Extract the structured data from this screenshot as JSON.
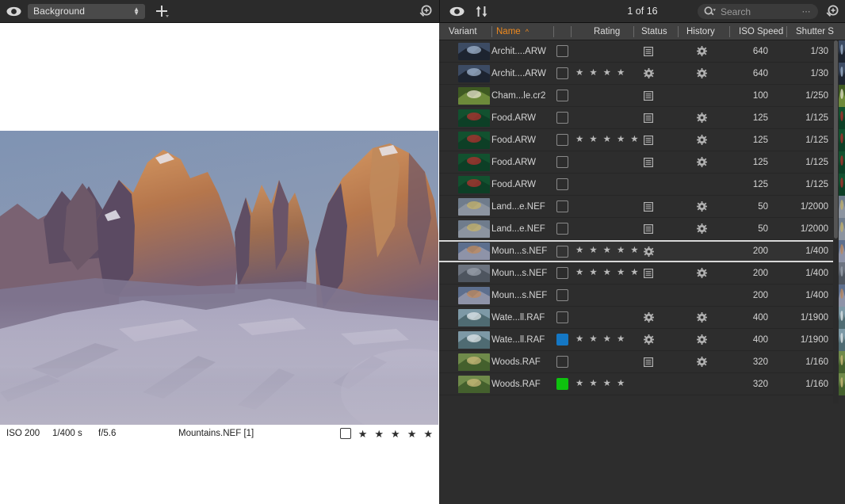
{
  "left_toolbar": {
    "eye_icon": "eye-icon",
    "background_select": {
      "value": "Background"
    },
    "add_icon": "plus-icon",
    "zoom_icon": "zoom-in-icon"
  },
  "viewer": {
    "photo_alt": "Mountains at sunset"
  },
  "info_bar": {
    "iso": "ISO 200",
    "shutter": "1/400 s",
    "aperture": "f/5.6",
    "filename": "Mountains.NEF [1]",
    "rating_checkbox": "unchecked",
    "stars": 5
  },
  "right_toolbar": {
    "eye_icon": "eye-icon",
    "sort_icon": "sort-arrows-icon",
    "count_label": "1 of 16",
    "search": {
      "placeholder": "Search",
      "value": "",
      "icon": "search-icon",
      "more_icon": "ellipsis-icon"
    },
    "zoom_icon": "zoom-in-icon"
  },
  "table": {
    "columns": [
      {
        "key": "variant",
        "label": "Variant"
      },
      {
        "key": "name",
        "label": "Name",
        "sorted": true,
        "sort_dir": "asc"
      },
      {
        "key": "rating",
        "label": "Rating"
      },
      {
        "key": "status",
        "label": "Status"
      },
      {
        "key": "history",
        "label": "History"
      },
      {
        "key": "iso",
        "label": "ISO Speed"
      },
      {
        "key": "shutter",
        "label": "Shutter S"
      }
    ],
    "sort_caret": "^",
    "rows": [
      {
        "name": "Archit....ARW",
        "label": "none",
        "stars": 0,
        "status": "list",
        "history": "gear",
        "iso": "640",
        "shutter": "1/30",
        "thumb": "architecture",
        "selected": false
      },
      {
        "name": "Archit....ARW",
        "label": "none",
        "stars": 4,
        "status": "gear",
        "history": "gear",
        "iso": "640",
        "shutter": "1/30",
        "thumb": "architecture",
        "selected": false
      },
      {
        "name": "Cham...le.cr2",
        "label": "none",
        "stars": 0,
        "status": "list",
        "history": "none",
        "iso": "100",
        "shutter": "1/250",
        "thumb": "chamomile",
        "selected": false
      },
      {
        "name": "Food.ARW",
        "label": "none",
        "stars": 0,
        "status": "list",
        "history": "gear",
        "iso": "125",
        "shutter": "1/125",
        "thumb": "food",
        "selected": false
      },
      {
        "name": "Food.ARW",
        "label": "none",
        "stars": 5,
        "status": "list",
        "history": "gear",
        "iso": "125",
        "shutter": "1/125",
        "thumb": "food",
        "selected": false
      },
      {
        "name": "Food.ARW",
        "label": "none",
        "stars": 0,
        "status": "list",
        "history": "gear",
        "iso": "125",
        "shutter": "1/125",
        "thumb": "food",
        "selected": false
      },
      {
        "name": "Food.ARW",
        "label": "none",
        "stars": 0,
        "status": "none",
        "history": "none",
        "iso": "125",
        "shutter": "1/125",
        "thumb": "food",
        "selected": false
      },
      {
        "name": "Land...e.NEF",
        "label": "none",
        "stars": 0,
        "status": "list",
        "history": "gear",
        "iso": "50",
        "shutter": "1/2000",
        "thumb": "landscape",
        "selected": false
      },
      {
        "name": "Land...e.NEF",
        "label": "none",
        "stars": 0,
        "status": "list",
        "history": "gear",
        "iso": "50",
        "shutter": "1/2000",
        "thumb": "landscape",
        "selected": false
      },
      {
        "name": "Moun...s.NEF",
        "label": "none",
        "stars": 5,
        "status": "gear",
        "history": "none",
        "iso": "200",
        "shutter": "1/400",
        "thumb": "mountains-warm",
        "selected": true
      },
      {
        "name": "Moun...s.NEF",
        "label": "none",
        "stars": 5,
        "status": "list",
        "history": "gear",
        "iso": "200",
        "shutter": "1/400",
        "thumb": "mountains-gray",
        "selected": false
      },
      {
        "name": "Moun...s.NEF",
        "label": "none",
        "stars": 0,
        "status": "none",
        "history": "none",
        "iso": "200",
        "shutter": "1/400",
        "thumb": "mountains-warm",
        "selected": false
      },
      {
        "name": "Wate...ll.RAF",
        "label": "none",
        "stars": 0,
        "status": "gear",
        "history": "gear",
        "iso": "400",
        "shutter": "1/1900",
        "thumb": "waterfall",
        "selected": false
      },
      {
        "name": "Wate...ll.RAF",
        "label": "blue",
        "stars": 4,
        "status": "gear",
        "history": "gear",
        "iso": "400",
        "shutter": "1/1900",
        "thumb": "waterfall",
        "selected": false
      },
      {
        "name": "Woods.RAF",
        "label": "none",
        "stars": 0,
        "status": "list",
        "history": "gear",
        "iso": "320",
        "shutter": "1/160",
        "thumb": "woods",
        "selected": false
      },
      {
        "name": "Woods.RAF",
        "label": "green",
        "stars": 4,
        "status": "none",
        "history": "none",
        "iso": "320",
        "shutter": "1/160",
        "thumb": "woods",
        "selected": false
      }
    ]
  },
  "colors": {
    "accent_sort": "#f08a1e",
    "label_blue": "#1477c4",
    "label_green": "#0ec20e",
    "panel_bg": "#2d2d2d",
    "header_bg": "#404040",
    "toolbar_bg": "#2b2b2b"
  }
}
